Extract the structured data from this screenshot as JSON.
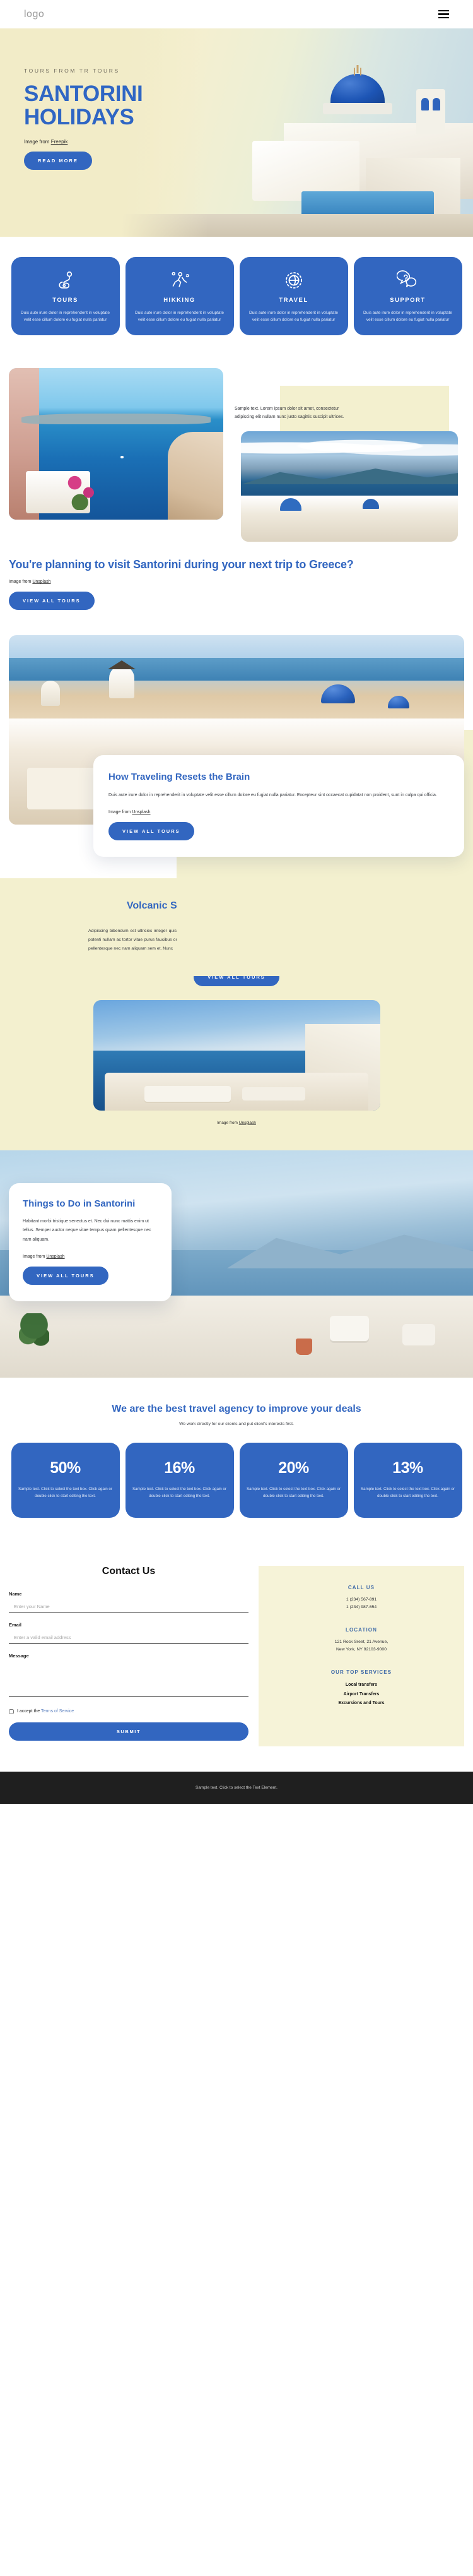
{
  "nav": {
    "logo": "logo",
    "menu_icon": "hamburger-menu-icon"
  },
  "hero": {
    "eyebrow": "TOURS FROM TR TOURS",
    "title_line1": "SANTORINI",
    "title_line2": "HOLIDAYS",
    "credit_prefix": "Image from ",
    "credit_link": "Freepik",
    "cta": "READ MORE"
  },
  "features": {
    "cards": [
      {
        "icon": "route-pin-icon",
        "title": "TOURS",
        "text": "Duis aute irure dolor in reprehenderit in voluptate velit esse cillum dolore eu fugiat nulla pariatur"
      },
      {
        "icon": "hiker-icon",
        "title": "HIKKING",
        "text": "Duis aute irure dolor in reprehenderit in voluptate velit esse cillum dolore eu fugiat nulla pariatur"
      },
      {
        "icon": "globe-icon",
        "title": "TRAVEL",
        "text": "Duis aute irure dolor in reprehenderit in voluptate velit esse cillum dolore eu fugiat nulla pariatur"
      },
      {
        "icon": "question-chat-icon",
        "title": "SUPPORT",
        "text": "Duis aute irure dolor in reprehenderit in voluptate velit esse cillum dolore eu fugiat nulla pariatur"
      }
    ]
  },
  "planning": {
    "note": "Sample text. Lorem ipsum dolor sit amet, consectetur adipiscing elit nullam nunc justo sagittis suscipit ultrices.",
    "heading": "You're planning to visit Santorini during your next trip to Greece?",
    "credit_prefix": "Image from ",
    "credit_link": "Unsplash",
    "cta": "VIEW ALL TOURS"
  },
  "brain": {
    "heading": "How Traveling Resets the Brain",
    "body": "Duis aute irure dolor in reprehenderit in voluptate velit esse cillum dolore eu fugiat nulla pariatur. Excepteur sint occaecat cupidatat non proident, sunt in culpa qui officia.",
    "credit_prefix": "Image from ",
    "credit_link": "Unsplash",
    "cta": "VIEW ALL TOURS"
  },
  "volcanic": {
    "heading": "Volcanic Santorini is home to unique beaches",
    "body": "Adipiscing bibendum est ultricies integer quis auctor elit. Eget nunc scelerisque viverra mauris in. Volutpat est velit egestas dui id. Viverra suspendisse potenti nullam ac tortor vitae purus faucibus ornare. Nulla pharetra diam sit amet nisl. Lorem ipsum dolor sit amet consectetur adipiscing elit. Tempus quam pellentesque nec nam aliquam sem et. Nunc",
    "cta": "VIEW ALL TOURS",
    "credit_prefix": "Image from ",
    "credit_link": "Unsplash"
  },
  "things": {
    "heading": "Things to Do in Santorini",
    "body": "Habitant morbi tristique senectus et. Nec dui nunc mattis enim ut tellus. Semper auctor neque vitae tempus quam pellentesque nec nam aliquam.",
    "credit_prefix": "Image from ",
    "credit_link": "Unsplash",
    "cta": "VIEW ALL TOURS"
  },
  "stats": {
    "heading": "We are the best travel agency to improve your deals",
    "subheading": "We work directly for our clients and put client's interests first.",
    "cards": [
      {
        "value": "50%",
        "text": "Sample text. Click to select the text box. Click again or double click to start editing the text."
      },
      {
        "value": "16%",
        "text": "Sample text. Click to select the text box. Click again or double click to start editing the text."
      },
      {
        "value": "20%",
        "text": "Sample text. Click to select the text box. Click again or double click to start editing the text."
      },
      {
        "value": "13%",
        "text": "Sample text. Click to select the text box. Click again or double click to start editing the text."
      }
    ]
  },
  "contact": {
    "title": "Contact Us",
    "name_label": "Name",
    "name_placeholder": "Enter your Name",
    "email_label": "Email",
    "email_placeholder": "Enter a valid email address",
    "message_label": "Message",
    "message_placeholder": "",
    "consent_prefix": "I accept the ",
    "consent_link": "Terms of Service",
    "submit": "SUBMIT",
    "call_us_title": "CALL US",
    "phone_1": "1 (234) 567-891",
    "phone_2": "1 (234) 987-654",
    "location_title": "LOCATION",
    "address_1": "121 Rock Sreet, 21 Avenue,",
    "address_2": "New York, NY 92103-9000",
    "services_title": "OUR TOP SERVICES",
    "services": [
      "Local transfers",
      "Airport Transfers",
      "Excursions and Tours"
    ]
  },
  "footer": {
    "text": "Sample text. Click to select the Text Element."
  },
  "colors": {
    "brand_blue": "#3266c0",
    "cream": "#f3f0cf",
    "dark": "#1f1f1f"
  }
}
